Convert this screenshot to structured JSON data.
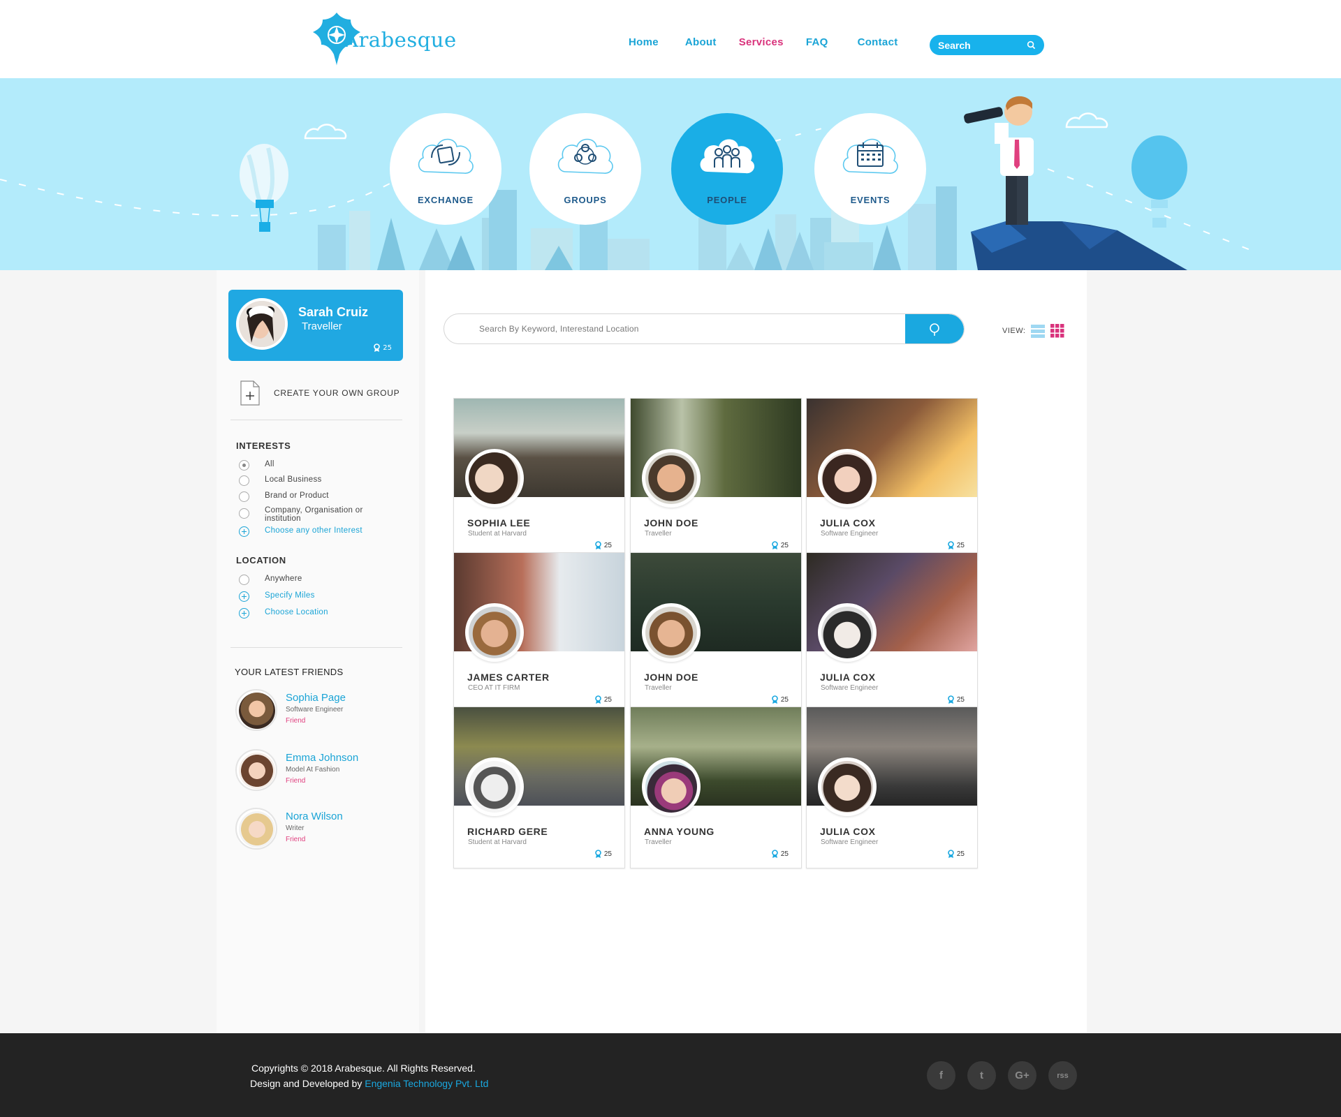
{
  "brand": {
    "name": "Arabesque",
    "color": "#21aee0"
  },
  "nav": {
    "items": [
      {
        "label": "Home",
        "active": false
      },
      {
        "label": "About",
        "active": false
      },
      {
        "label": "Services",
        "active": true
      },
      {
        "label": "FAQ",
        "active": false
      },
      {
        "label": "Contact",
        "active": false
      }
    ],
    "search_label": "Search"
  },
  "hero": {
    "categories": [
      {
        "label": "EXCHANGE",
        "icon": "exchange-icon",
        "active": false
      },
      {
        "label": "GROUPS",
        "icon": "groups-icon",
        "active": false
      },
      {
        "label": "PEOPLE",
        "icon": "people-icon",
        "active": true
      },
      {
        "label": "EVENTS",
        "icon": "events-icon",
        "active": false
      }
    ]
  },
  "profile": {
    "name": "Sarah Cruiz",
    "role": "Traveller",
    "points": "25"
  },
  "sidebar": {
    "create_group_label": "CREATE YOUR OWN GROUP",
    "interests_title": "INTERESTS",
    "interests": [
      {
        "label": "All",
        "checked": true
      },
      {
        "label": "Local Business",
        "checked": false
      },
      {
        "label": "Brand or Product",
        "checked": false
      },
      {
        "label": "Company, Organisation or institution",
        "checked": false
      }
    ],
    "interests_more": "Choose any other Interest",
    "location_title": "LOCATION",
    "location_options": [
      {
        "label": "Anywhere",
        "checked": false
      }
    ],
    "location_links": [
      "Specify Miles",
      "Choose Location"
    ],
    "friends_title": "YOUR  LATEST FRIENDS",
    "friends": [
      {
        "name": "Sophia Page",
        "job": "Software Engineer",
        "status": "Friend"
      },
      {
        "name": "Emma Johnson",
        "job": "Model At Fashion",
        "status": "Friend"
      },
      {
        "name": "Nora Wilson",
        "job": "Writer",
        "status": "Friend"
      }
    ]
  },
  "main": {
    "search_placeholder": "Search By Keyword,  Interestand  Location",
    "view_label": "VIEW:",
    "people": [
      {
        "name": "SOPHIA LEE",
        "job": "Student at Harvard",
        "points": "25"
      },
      {
        "name": "JOHN DOE",
        "job": "Traveller",
        "points": "25"
      },
      {
        "name": "JULIA COX",
        "job": "Software Engineer",
        "points": "25"
      },
      {
        "name": "JAMES CARTER",
        "job": "CEO AT IT FIRM",
        "points": "25"
      },
      {
        "name": "JOHN DOE",
        "job": "Traveller",
        "points": "25"
      },
      {
        "name": "JULIA COX",
        "job": "Software Engineer",
        "points": "25"
      },
      {
        "name": "RICHARD GERE",
        "job": "Student at Harvard",
        "points": "25"
      },
      {
        "name": "ANNA YOUNG",
        "job": "Traveller",
        "points": "25"
      },
      {
        "name": "JULIA COX",
        "job": "Software Engineer",
        "points": "25"
      }
    ]
  },
  "footer": {
    "copyright": "Copyrights  © 2018 Arabesque. All Rights Reserved.",
    "dev_prefix": "Design and Developed by ",
    "dev_company": "Engenia Technology Pvt. Ltd",
    "socials": [
      {
        "icon": "facebook-icon",
        "glyph": "f"
      },
      {
        "icon": "twitter-icon",
        "glyph": "t"
      },
      {
        "icon": "google-plus-icon",
        "glyph": "G+"
      },
      {
        "icon": "rss-icon",
        "glyph": "rss"
      }
    ]
  },
  "colors": {
    "accent": "#1aa8e0",
    "active_nav": "#d9337c",
    "hero_bg": "#b3ebfb",
    "footer_bg": "#232323"
  }
}
